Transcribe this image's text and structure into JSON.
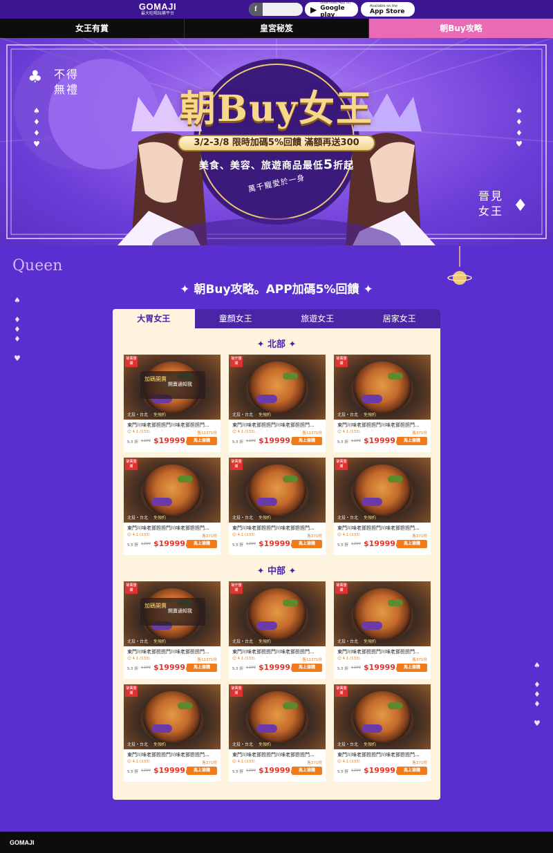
{
  "brand": {
    "logo": "GOMAJI",
    "tagline": "最大吃喝玩樂平台"
  },
  "topbar": {
    "google_play": {
      "small": "Download App on",
      "big": "Google play"
    },
    "app_store": {
      "small": "Available on the",
      "big": "App Store"
    }
  },
  "nav": {
    "tabs": [
      "女王有賞",
      "皇宮秘笈",
      "朝Buy攻略"
    ],
    "active_index": 2
  },
  "hero": {
    "left_text": [
      "不得",
      "無禮"
    ],
    "right_text": [
      "晉見",
      "女王"
    ],
    "title": "朝Buy女王",
    "promo": "3/2-3/8 限時加碼5%回饋 滿額再送300",
    "sub": "美食、美容、旅遊商品最低",
    "sub_big": "5",
    "sub_tail": "折起",
    "ribbon": "萬千寵愛於一身"
  },
  "section": {
    "script_title": "Queen",
    "title": "朝Buy攻略。APP加碼5%回饋"
  },
  "panel": {
    "tabs": [
      "大胃女王",
      "童顏女王",
      "旅遊女王",
      "居家女王"
    ],
    "active_tab": 0,
    "regions": [
      {
        "name": "北部",
        "cards": [
          {
            "badge": "破萬團購",
            "overlay": {
              "tag": "加碼開賣",
              "notify": "開賣通知我"
            },
            "location": "北投・台北",
            "reserve": "免預約",
            "name": "東門川味老鄧担担門川味老鄧担担門...",
            "rating": "4.1 (133)",
            "sold": "售11371份",
            "discount": "5.5 折",
            "orig": "$299",
            "price": "$19999",
            "unit": "起",
            "buy": "馬上搶購"
          },
          {
            "badge": "破仟團購",
            "location": "北投・台北",
            "reserve": "免預約",
            "name": "東門川味老鄧担担門川味老鄧担担門...",
            "rating": "4.1 (133)",
            "sold": "售11371份",
            "discount": "5.5 折",
            "orig": "$299",
            "price": "$19999",
            "unit": "起",
            "buy": "馬上搶購"
          },
          {
            "badge": "破萬團購",
            "location": "北投・台北",
            "reserve": "免預約",
            "name": "東門川味老鄧担担門川味老鄧担担門...",
            "rating": "4.1 (133)",
            "sold": "售371份",
            "discount": "5.5 折",
            "orig": "$299",
            "price": "$19999",
            "unit": "起",
            "buy": "馬上搶購"
          },
          {
            "badge": "破萬團購",
            "location": "北投・台北",
            "reserve": "免預約",
            "name": "東門川味老鄧担担門川味老鄧担担門...",
            "rating": "4.1 (133)",
            "sold": "售371份",
            "discount": "5.5 折",
            "orig": "$299",
            "price": "$19999",
            "unit": "起",
            "buy": "馬上搶購"
          },
          {
            "badge": "破萬團購",
            "location": "北投・台北",
            "reserve": "免預約",
            "name": "東門川味老鄧担担門川味老鄧担担門...",
            "rating": "4.1 (133)",
            "sold": "售371份",
            "discount": "5.5 折",
            "orig": "$299",
            "price": "$19999",
            "unit": "起",
            "buy": "馬上搶購"
          },
          {
            "badge": "破萬團購",
            "location": "北投・台北",
            "reserve": "免預約",
            "name": "東門川味老鄧担担門川味老鄧担担門...",
            "rating": "4.1 (133)",
            "sold": "售371份",
            "discount": "5.5 折",
            "orig": "$299",
            "price": "$19999",
            "unit": "起",
            "buy": "馬上搶購"
          }
        ]
      },
      {
        "name": "中部",
        "cards": [
          {
            "badge": "破萬團購",
            "overlay": {
              "tag": "加碼開賣",
              "notify": "開賣通知我"
            },
            "location": "北投・台北",
            "reserve": "免預約",
            "name": "東門川味老鄧担担門川味老鄧担担門...",
            "rating": "4.1 (133)",
            "sold": "售11371份",
            "discount": "5.5 折",
            "orig": "$299",
            "price": "$19999",
            "unit": "起",
            "buy": "馬上搶購"
          },
          {
            "badge": "破仟團購",
            "location": "北投・台北",
            "reserve": "免預約",
            "name": "東門川味老鄧担担門川味老鄧担担門...",
            "rating": "4.1 (133)",
            "sold": "售11371份",
            "discount": "5.5 折",
            "orig": "$299",
            "price": "$19999",
            "unit": "起",
            "buy": "馬上搶購"
          },
          {
            "badge": "破萬團購",
            "location": "北投・台北",
            "reserve": "免預約",
            "name": "東門川味老鄧担担門川味老鄧担担門...",
            "rating": "4.1 (133)",
            "sold": "售371份",
            "discount": "5.5 折",
            "orig": "$299",
            "price": "$19999",
            "unit": "起",
            "buy": "馬上搶購"
          },
          {
            "badge": "破萬團購",
            "location": "北投・台北",
            "reserve": "免預約",
            "name": "東門川味老鄧担担門川味老鄧担担門...",
            "rating": "4.1 (133)",
            "sold": "售371份",
            "discount": "5.5 折",
            "orig": "$299",
            "price": "$19999",
            "unit": "起",
            "buy": "馬上搶購"
          },
          {
            "badge": "破萬團購",
            "location": "北投・台北",
            "reserve": "免預約",
            "name": "東門川味老鄧担担門川味老鄧担担門...",
            "rating": "4.1 (133)",
            "sold": "售371份",
            "discount": "5.5 折",
            "orig": "$299",
            "price": "$19999",
            "unit": "起",
            "buy": "馬上搶購"
          },
          {
            "badge": "破萬團購",
            "location": "北投・台北",
            "reserve": "免預約",
            "name": "東門川味老鄧担担門川味老鄧担担門...",
            "rating": "4.1 (133)",
            "sold": "售371份",
            "discount": "5.5 折",
            "orig": "$299",
            "price": "$19999",
            "unit": "起",
            "buy": "馬上搶購"
          }
        ]
      }
    ]
  },
  "footer": {
    "logo": "GOMAJI"
  },
  "colors": {
    "accent": "#4a25a6",
    "nav_active": "#e96bb6",
    "buy": "#f07c1c",
    "price": "#e53227",
    "gold": "#f5d88a"
  }
}
